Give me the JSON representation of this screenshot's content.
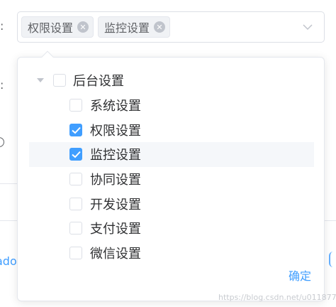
{
  "form": {
    "colon_1": ":",
    "colon_2": ":",
    "link_text": "ado"
  },
  "select": {
    "tags": [
      {
        "label": "权限设置"
      },
      {
        "label": "监控设置"
      }
    ],
    "arrow_icon": "chevron-down-icon"
  },
  "tree": {
    "parent": {
      "label": "后台设置",
      "checked": false,
      "expanded": true
    },
    "children": [
      {
        "label": "系统设置",
        "checked": false
      },
      {
        "label": "权限设置",
        "checked": true
      },
      {
        "label": "监控设置",
        "checked": true,
        "hovered": true
      },
      {
        "label": "协同设置",
        "checked": false
      },
      {
        "label": "开发设置",
        "checked": false
      },
      {
        "label": "支付设置",
        "checked": false
      },
      {
        "label": "微信设置",
        "checked": false
      }
    ]
  },
  "footer": {
    "confirm_label": "确定"
  },
  "watermark": "https://blog.csdn.net/u011877155",
  "colors": {
    "accent": "#409eff",
    "border": "#dcdfe6",
    "tag_bg": "#f0f2f5",
    "hover_bg": "#f5f7fa"
  }
}
